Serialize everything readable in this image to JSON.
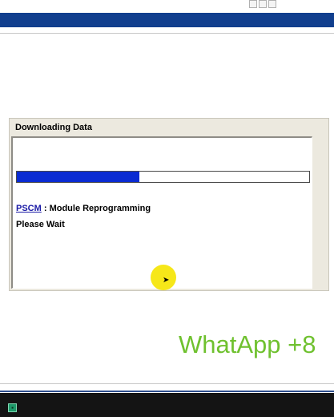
{
  "dialog": {
    "title": "Downloading Data",
    "progress_fraction": 0.42,
    "module_link": "PSCM",
    "module_separator": " : ",
    "module_action": "Module Reprogramming",
    "wait_text": "Please Wait"
  },
  "watermark": {
    "text": "WhatApp +8"
  },
  "colors": {
    "header_bar": "#113f8e",
    "progress_fill": "#0a2bd2",
    "dialog_bg": "#ece9df",
    "watermark": "#6fc12f",
    "cursor_highlight": "#f5e400",
    "taskbar": "#141414"
  },
  "icons": {
    "window_controls": "window-controls-icon",
    "cursor": "mouse-cursor-icon",
    "taskbar_app": "taskbar-app-icon"
  }
}
